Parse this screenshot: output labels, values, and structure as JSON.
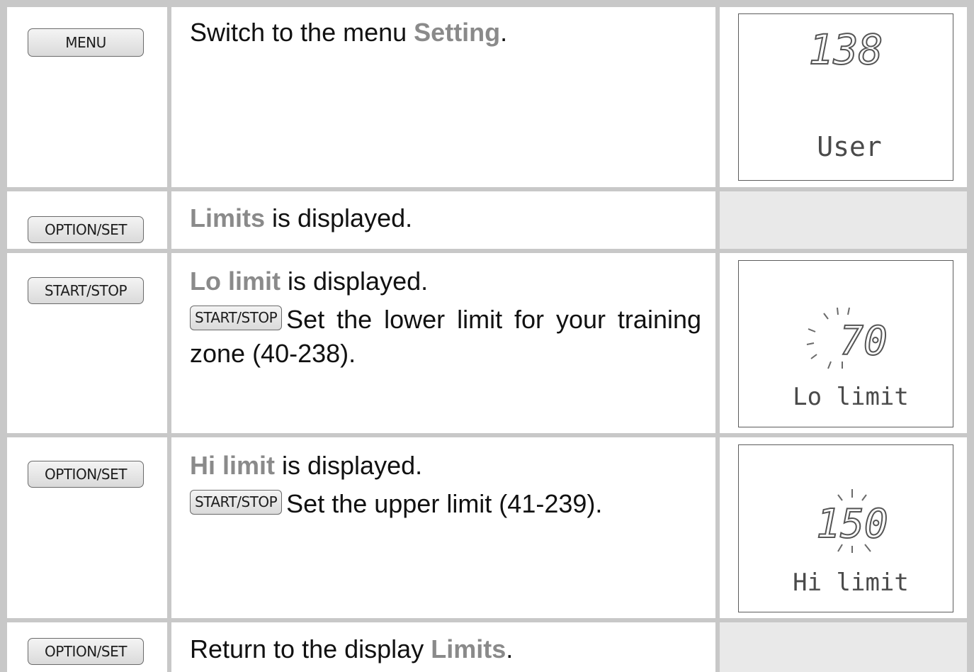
{
  "rows": [
    {
      "button": "MENU",
      "text_pre": "Switch to the menu ",
      "keyword": "Setting",
      "text_post": ".",
      "lcd": {
        "value": "138",
        "label": "User"
      }
    },
    {
      "button": "OPTION/SET",
      "keyword": "Limits",
      "text_post": " is displayed."
    },
    {
      "button": "START/STOP",
      "keyword": "Lo limit",
      "text_post": " is displayed.",
      "sub_button": "START/STOP",
      "sub_text": "Set the lower limit for your training zone (40-238).",
      "lcd": {
        "value": "70",
        "label": "Lo limit"
      }
    },
    {
      "button": "OPTION/SET",
      "keyword": "Hi limit",
      "text_post": " is displayed.",
      "sub_button": "START/STOP",
      "sub_text": "Set the upper limit (41-239).",
      "lcd": {
        "value": "150",
        "label": "Hi limit"
      }
    },
    {
      "button": "OPTION/SET",
      "text_pre": "Return to the display ",
      "keyword": "Limits",
      "text_post": "."
    }
  ]
}
